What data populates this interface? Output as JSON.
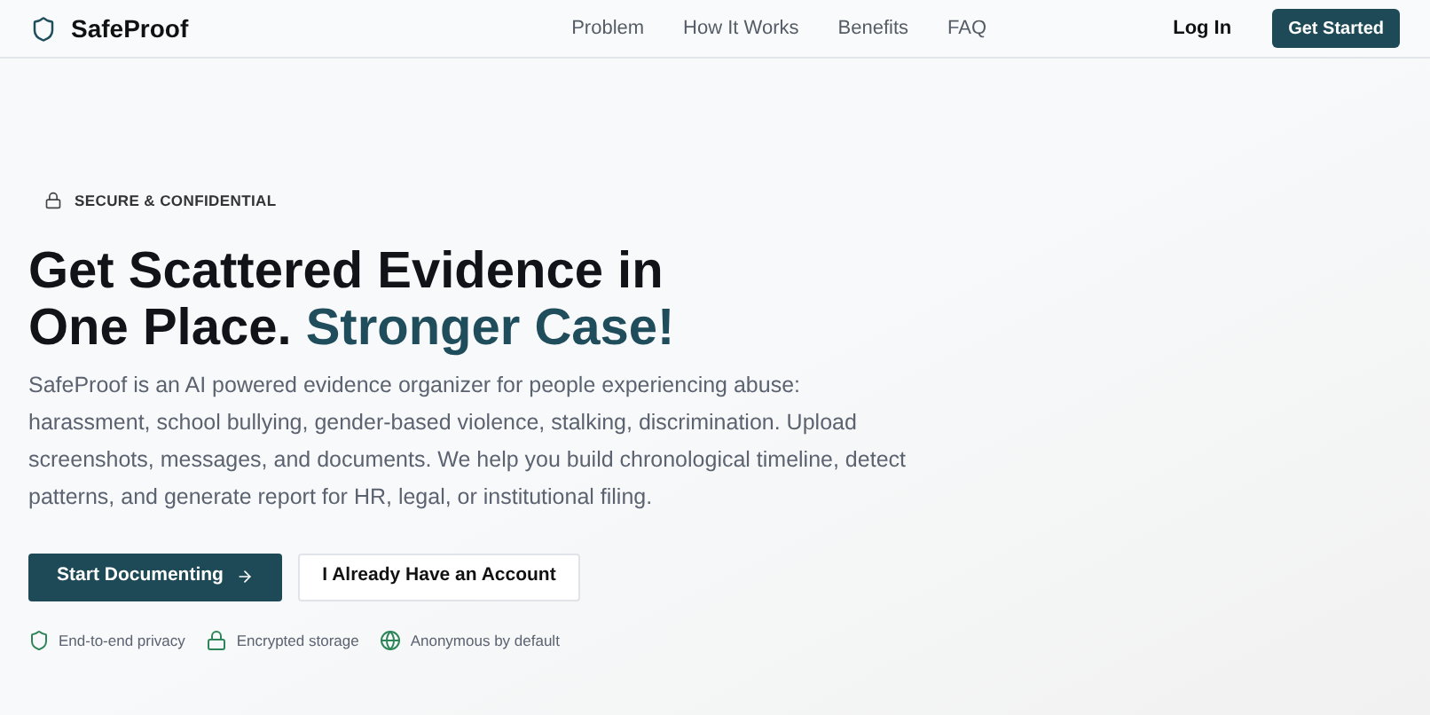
{
  "nav": {
    "brand": "SafeProof",
    "links": [
      "Problem",
      "How It Works",
      "Benefits",
      "FAQ"
    ],
    "login": "Log In",
    "cta": "Get Started"
  },
  "hero": {
    "badge": "SECURE & CONFIDENTIAL",
    "headline": [
      [
        {
          "text": "Get Scattered Evidence in",
          "kind": "plain"
        }
      ],
      [
        {
          "text": "One Place.",
          "kind": "plain"
        },
        {
          "text": "Stronger Case!",
          "kind": "accent"
        }
      ]
    ],
    "description": "SafeProof is an AI powered evidence organizer for people experiencing abuse: harassment, school bullying, gender-based violence, stalking, discrimination. Upload screenshots, messages, and documents. We help you build chronological timeline, detect patterns, and generate report for HR, legal, or institutional filing.",
    "buttons": [
      {
        "label": "Start Documenting",
        "kind": "primary"
      },
      {
        "label": "I Already Have an Account",
        "kind": "secondary"
      }
    ],
    "trust": [
      {
        "label": "End-to-end privacy",
        "kind": "shield"
      },
      {
        "label": "Encrypted storage",
        "kind": "lock"
      },
      {
        "label": "Anonymous by default",
        "kind": "globe"
      }
    ]
  }
}
